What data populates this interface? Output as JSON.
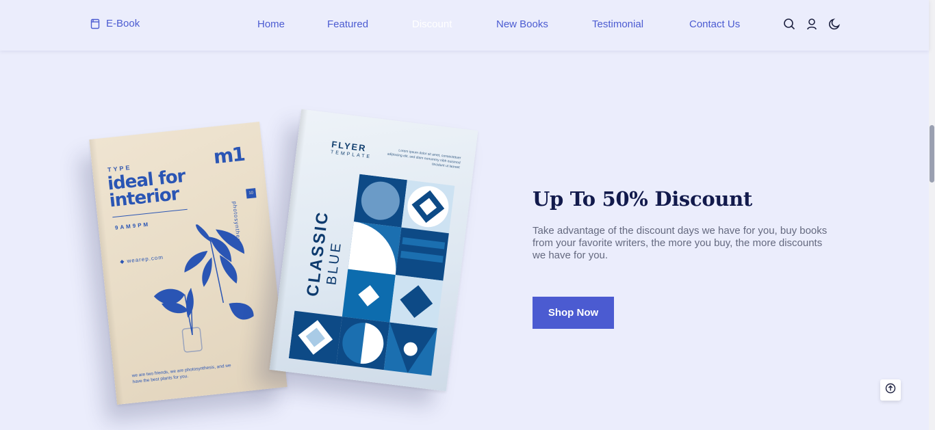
{
  "header": {
    "logo_text": "E-Book",
    "logo_icon": "book-icon",
    "nav": [
      {
        "label": "Home",
        "active": false
      },
      {
        "label": "Featured",
        "active": false
      },
      {
        "label": "Discount",
        "active": true
      },
      {
        "label": "New Books",
        "active": false
      },
      {
        "label": "Testimonial",
        "active": false
      },
      {
        "label": "Contact Us",
        "active": false
      }
    ],
    "tools": [
      "search-icon",
      "user-icon",
      "moon-icon"
    ]
  },
  "books": {
    "book_1": {
      "type": "TYPE",
      "title": "ideal for interior",
      "time": "9AM9PM",
      "website": "◆ wearep.com",
      "side": "photosynthesis",
      "mark": "m1",
      "chip": "10",
      "footer": "we are two friends, we are photosynthesis, and we have the best plants for you."
    },
    "book_2": {
      "flyer": "FLYER",
      "template": "TEMPLATE",
      "lorem": "Lorem ipsum dolor sit amet, consectetuer adipiscing elit, sed diam nonummy nibh euismod tincidunt ut laoreet",
      "classic": "CLASSIC",
      "blue": "BLUE"
    }
  },
  "discount": {
    "title": "Up To 50% Discount",
    "description": "Take advantage of the discount days we have for you, buy books from your favorite writers, the more you buy, the more discounts we have for you.",
    "button_label": "Shop Now"
  },
  "colors": {
    "accent": "#4b5bd1",
    "background": "#ebedfc",
    "title": "#121a4c",
    "body_text": "#64697f"
  },
  "scroll_top_icon": "arrow-up-circle-icon"
}
